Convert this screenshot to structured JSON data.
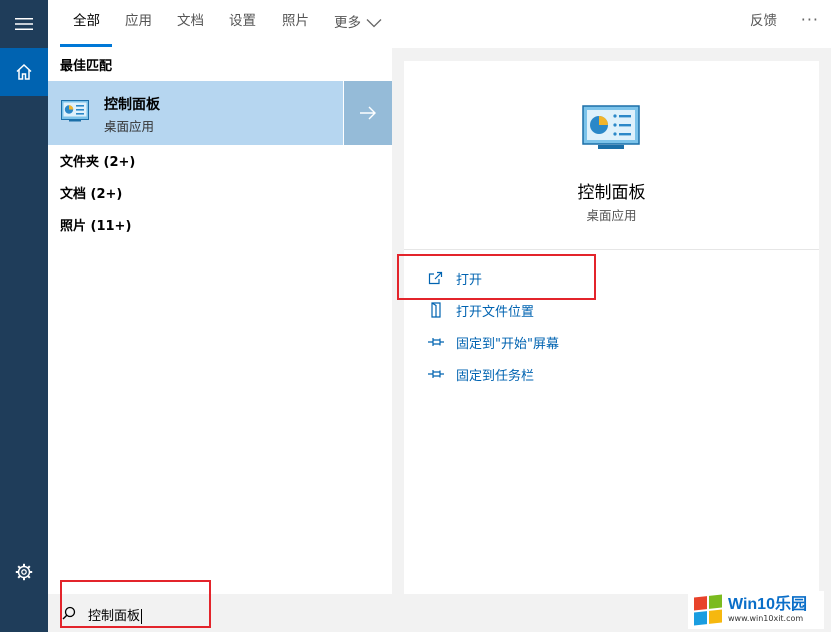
{
  "tabs": [
    {
      "label": "全部",
      "active": true
    },
    {
      "label": "应用"
    },
    {
      "label": "文档"
    },
    {
      "label": "设置"
    },
    {
      "label": "照片"
    },
    {
      "label": "更多"
    }
  ],
  "top_right": {
    "feedback": "反馈",
    "more": "···"
  },
  "rail": {
    "icons": [
      "hamburger-icon",
      "home-icon",
      "gear-icon"
    ],
    "active_color": "#0063b1",
    "bg_color": "#1f3d5a"
  },
  "results": {
    "best_heading": "最佳匹配",
    "best_item": {
      "name": "控制面板",
      "type": "桌面应用",
      "icon": "control-panel-icon"
    },
    "categories": [
      "文件夹 (2+)",
      "文档 (2+)",
      "照片 (11+)"
    ]
  },
  "detail": {
    "title": "控制面板",
    "subtitle": "桌面应用",
    "actions": [
      {
        "label": "打开",
        "icon": "open-icon"
      },
      {
        "label": "打开文件位置",
        "icon": "file-location-icon"
      },
      {
        "label": "固定到\"开始\"屏幕",
        "icon": "pin-icon"
      },
      {
        "label": "固定到任务栏",
        "icon": "pin-icon"
      }
    ]
  },
  "search": {
    "query": "控制面板",
    "icon": "search-icon"
  },
  "watermark": {
    "brand": "Win10乐园",
    "url": "www.win10xit.com"
  },
  "colors": {
    "accent": "#0078d7",
    "link": "#0063b1",
    "highlight_red": "#e3242b",
    "selected_bg": "#b6d6f0"
  }
}
